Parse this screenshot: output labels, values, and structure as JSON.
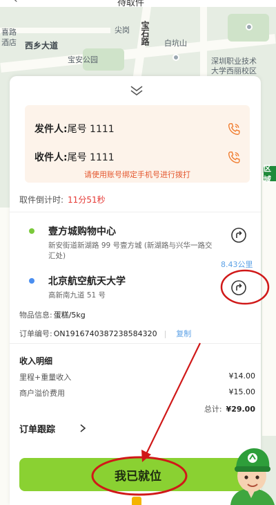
{
  "header": {
    "title": "待取件"
  },
  "map": {
    "labels": [
      "喜路",
      "酒店",
      "西乡大道",
      "尖岗",
      "宝石路",
      "白坑山",
      "宝安公园",
      "深圳职业技术",
      "大学西丽校区"
    ],
    "edge_tag": "区域"
  },
  "contacts": {
    "sender_label": "发件人:",
    "sender_value": "尾号 1111",
    "receiver_label": "收件人:",
    "receiver_value": "尾号 1111",
    "hint": "请使用账号绑定手机号进行拨打"
  },
  "countdown": {
    "label": "取件倒计时:",
    "time": "11分51秒"
  },
  "pickup": {
    "name": "壹方城购物中心",
    "detail": "新安街道新湖路 99 号壹方城 (新湖路与兴华一路交汇处)",
    "dot_color": "#7ac93b"
  },
  "distance": "8.43公里",
  "delivery": {
    "name": "北京航空航天大学",
    "detail": "高新南九道 51 号",
    "dot_color": "#4a8ef0"
  },
  "goods": {
    "label": "物品信息:",
    "value": "蛋糕/5kg"
  },
  "order": {
    "label": "订单编号:",
    "value": "ON1916740387238584320",
    "copy": "复制"
  },
  "income": {
    "title": "收入明细",
    "rows": [
      {
        "label": "里程+重量收入",
        "amount": "¥14.00"
      },
      {
        "label": "商户溢价费用",
        "amount": "¥15.00"
      }
    ],
    "total_label": "总计:",
    "total_amount": "¥29.00"
  },
  "tracking": {
    "label": "订单跟踪"
  },
  "arrive_button": {
    "label": "我已就位"
  },
  "colors": {
    "accent": "#8ad132",
    "annotation": "#d01818",
    "phone": "#f07a2c"
  }
}
